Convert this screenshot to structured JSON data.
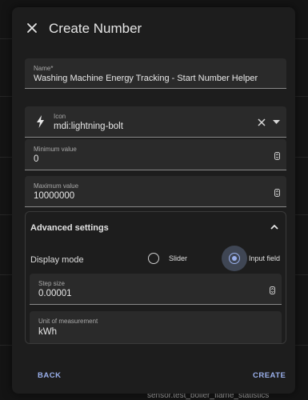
{
  "dialog": {
    "title": "Create Number",
    "name_field": {
      "label": "Name*",
      "value": "Washing Machine Energy Tracking - Start Number Helper"
    },
    "icon_field": {
      "label": "Icon",
      "value": "mdi:lightning-bolt",
      "icon": "lightning-bolt-icon"
    },
    "min_field": {
      "label": "Minimum value",
      "value": "0"
    },
    "max_field": {
      "label": "Maximum value",
      "value": "10000000"
    },
    "advanced": {
      "title": "Advanced settings",
      "display_mode_label": "Display mode",
      "options": [
        {
          "label": "Slider",
          "selected": false
        },
        {
          "label": "Input field",
          "selected": true
        }
      ],
      "step_field": {
        "label": "Step size",
        "value": "0.00001"
      },
      "unit_field": {
        "label": "Unit of measurement",
        "value": "kWh"
      }
    },
    "back_label": "BACK",
    "create_label": "CREATE",
    "accent_color": "#9ab0ec"
  },
  "background": {
    "partial_text": "sensor.test_boiler_flame_statistics"
  }
}
